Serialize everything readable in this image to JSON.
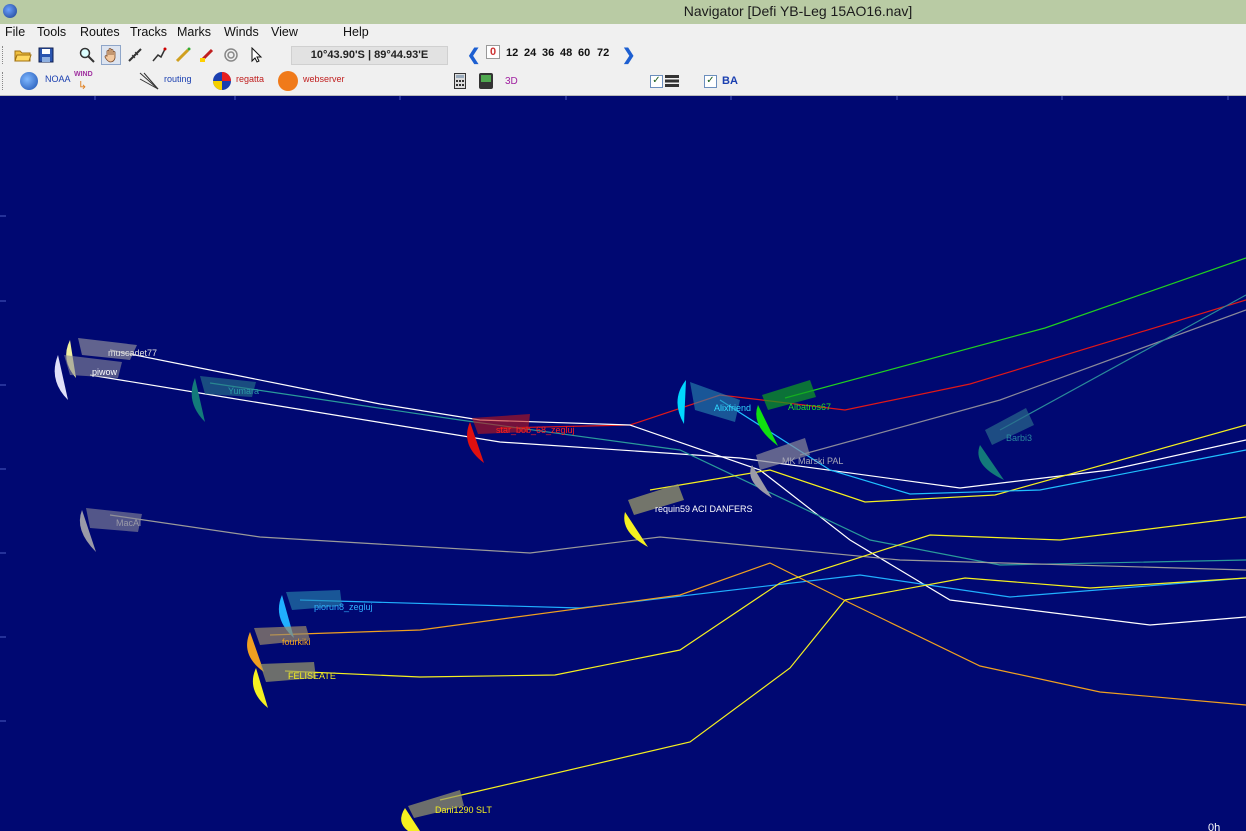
{
  "window": {
    "title": "Navigator [Defi YB-Leg 15AO16.nav]"
  },
  "menu": {
    "file": "File",
    "tools": "Tools",
    "routes": "Routes",
    "tracks": "Tracks",
    "marks": "Marks",
    "winds": "Winds",
    "view": "View",
    "help": "Help"
  },
  "toolbar": {
    "coords": "10°43.90'S | 89°44.93'E",
    "hours": [
      "0",
      "12",
      "24",
      "36",
      "48",
      "60",
      "72"
    ],
    "selected_hour": "0"
  },
  "toolbar2": {
    "noaa": "NOAA",
    "wind": "WIND",
    "routing": "routing",
    "regatta": "regatta",
    "webserver": "webserver",
    "three_d": "3D",
    "ba": "BA"
  },
  "chart_footer": "0h",
  "boats": [
    {
      "name": "muscadet77",
      "color": "#d8d8d8"
    },
    {
      "name": "piwow",
      "color": "#ffffff"
    },
    {
      "name": "Yumara",
      "color": "#1a8a8a"
    },
    {
      "name": "star_bob_68_zegluj",
      "color": "#ff1010"
    },
    {
      "name": "Alixfriend",
      "color": "#00d8ff"
    },
    {
      "name": "Albatros67",
      "color": "#10e010"
    },
    {
      "name": "Barbi3",
      "color": "#2a7a8a"
    },
    {
      "name": "MK Marski PAL",
      "color": "#9a9a9a"
    },
    {
      "name": "requin59 ACI DANFERS",
      "color": "#ffffff"
    },
    {
      "name": "MacAl",
      "color": "#9a9a9a"
    },
    {
      "name": "piorun8_zegluj",
      "color": "#20b0ff"
    },
    {
      "name": "fourkiki",
      "color": "#f0a020"
    },
    {
      "name": "FELISEATE",
      "color": "#f5f020"
    },
    {
      "name": "Dani1290 SLT",
      "color": "#f5f020"
    }
  ]
}
